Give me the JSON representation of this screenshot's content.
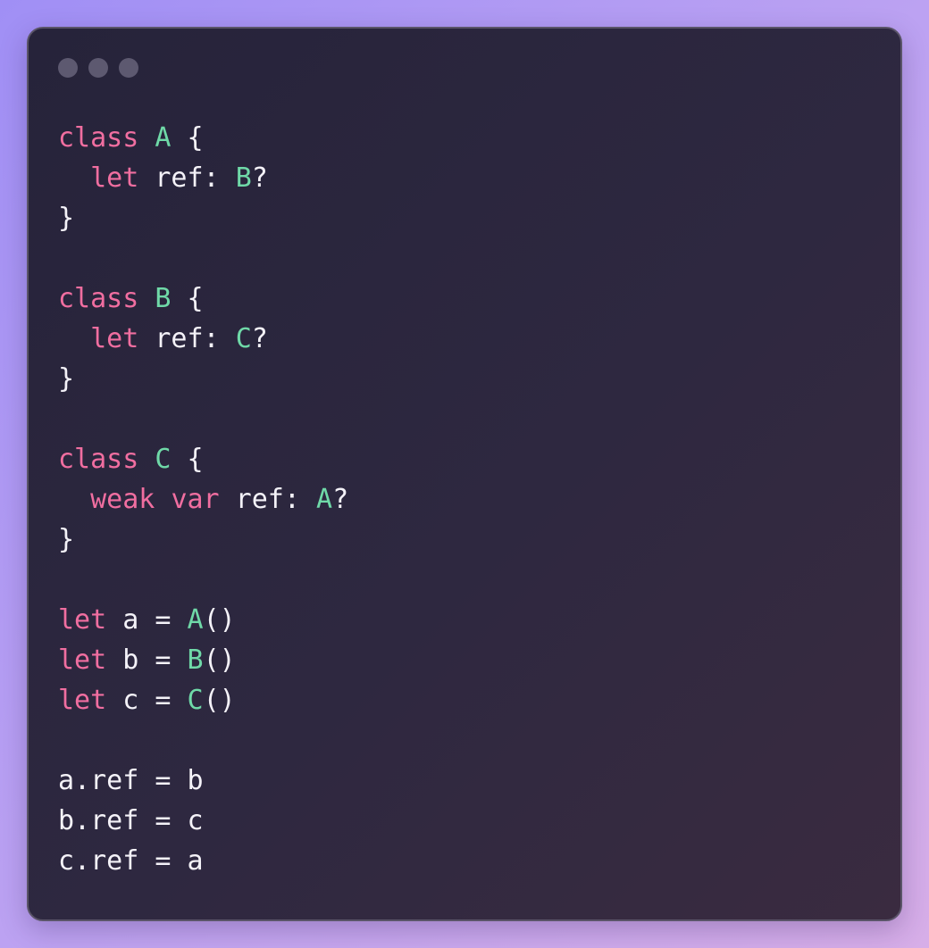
{
  "window": {
    "buttons": [
      "close",
      "minimize",
      "zoom"
    ]
  },
  "colors": {
    "keyword": "#f06ea0",
    "type": "#6fd9a8",
    "text": "#f4f2f8",
    "background": "#2a2538",
    "window_dot": "#5d5970"
  },
  "code": {
    "lines": [
      [
        {
          "t": "kw",
          "s": "class"
        },
        {
          "t": "pl",
          "s": " "
        },
        {
          "t": "ty",
          "s": "A"
        },
        {
          "t": "pl",
          "s": " {"
        }
      ],
      [
        {
          "t": "pl",
          "s": "  "
        },
        {
          "t": "kw",
          "s": "let"
        },
        {
          "t": "pl",
          "s": " ref: "
        },
        {
          "t": "ty",
          "s": "B"
        },
        {
          "t": "pl",
          "s": "?"
        }
      ],
      [
        {
          "t": "pl",
          "s": "}"
        }
      ],
      [],
      [
        {
          "t": "kw",
          "s": "class"
        },
        {
          "t": "pl",
          "s": " "
        },
        {
          "t": "ty",
          "s": "B"
        },
        {
          "t": "pl",
          "s": " {"
        }
      ],
      [
        {
          "t": "pl",
          "s": "  "
        },
        {
          "t": "kw",
          "s": "let"
        },
        {
          "t": "pl",
          "s": " ref: "
        },
        {
          "t": "ty",
          "s": "C"
        },
        {
          "t": "pl",
          "s": "?"
        }
      ],
      [
        {
          "t": "pl",
          "s": "}"
        }
      ],
      [],
      [
        {
          "t": "kw",
          "s": "class"
        },
        {
          "t": "pl",
          "s": " "
        },
        {
          "t": "ty",
          "s": "C"
        },
        {
          "t": "pl",
          "s": " {"
        }
      ],
      [
        {
          "t": "pl",
          "s": "  "
        },
        {
          "t": "kw",
          "s": "weak"
        },
        {
          "t": "pl",
          "s": " "
        },
        {
          "t": "kw",
          "s": "var"
        },
        {
          "t": "pl",
          "s": " ref: "
        },
        {
          "t": "ty",
          "s": "A"
        },
        {
          "t": "pl",
          "s": "?"
        }
      ],
      [
        {
          "t": "pl",
          "s": "}"
        }
      ],
      [],
      [
        {
          "t": "kw",
          "s": "let"
        },
        {
          "t": "pl",
          "s": " a = "
        },
        {
          "t": "ty",
          "s": "A"
        },
        {
          "t": "pl",
          "s": "()"
        }
      ],
      [
        {
          "t": "kw",
          "s": "let"
        },
        {
          "t": "pl",
          "s": " b = "
        },
        {
          "t": "ty",
          "s": "B"
        },
        {
          "t": "pl",
          "s": "()"
        }
      ],
      [
        {
          "t": "kw",
          "s": "let"
        },
        {
          "t": "pl",
          "s": " c = "
        },
        {
          "t": "ty",
          "s": "C"
        },
        {
          "t": "pl",
          "s": "()"
        }
      ],
      [],
      [
        {
          "t": "pl",
          "s": "a.ref = b"
        }
      ],
      [
        {
          "t": "pl",
          "s": "b.ref = c"
        }
      ],
      [
        {
          "t": "pl",
          "s": "c.ref = a"
        }
      ]
    ]
  }
}
